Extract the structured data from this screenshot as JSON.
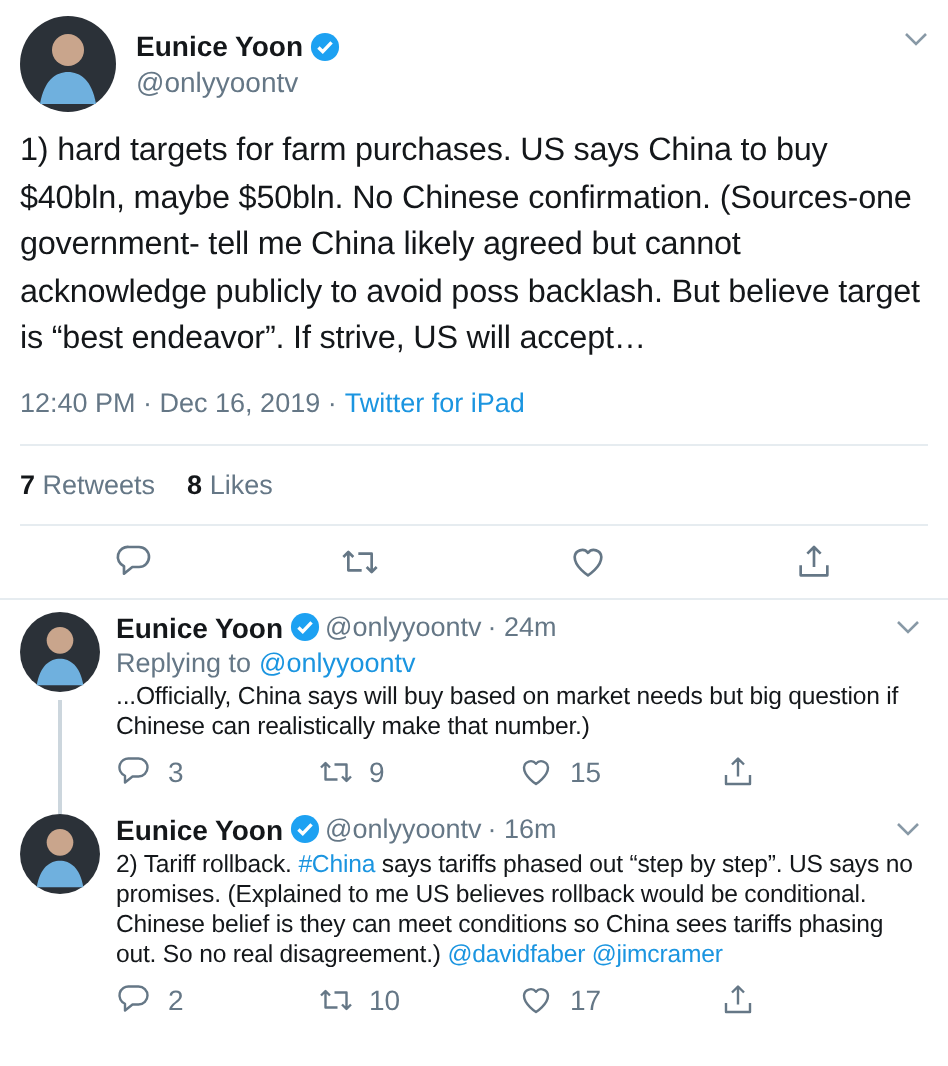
{
  "main_tweet": {
    "name": "Eunice Yoon",
    "verified": true,
    "handle": "@onlyyoontv",
    "text": "1) hard targets for farm purchases. US says China to buy $40bln, maybe $50bln. No Chinese confirmation. (Sources-one government- tell me China likely agreed but cannot acknowledge publicly to avoid poss backlash. But believe target is “best endeavor”. If strive, US will accept…",
    "timestamp": "12:40 PM · Dec 16, 2019 ·",
    "source": "Twitter for iPad",
    "stats": [
      {
        "count": "7",
        "label": "Retweets"
      },
      {
        "count": "8",
        "label": "Likes"
      }
    ],
    "actions": [
      {
        "kind": "reply"
      },
      {
        "kind": "retweet"
      },
      {
        "kind": "like"
      },
      {
        "kind": "share"
      }
    ]
  },
  "replies": [
    {
      "name": "Eunice Yoon",
      "verified": true,
      "handle": "@onlyyoontv",
      "time": "· 24m",
      "replying_label": "Replying to",
      "replying_handle": "@onlyyoontv",
      "thread_line": true,
      "segments": [
        {
          "kind": "text",
          "text": "...Officially, China says will buy based on market needs but big question if Chinese can realistically make that number.)"
        }
      ],
      "actions": [
        {
          "kind": "reply",
          "count": "3"
        },
        {
          "kind": "retweet",
          "count": "9"
        },
        {
          "kind": "like",
          "count": "15"
        },
        {
          "kind": "share"
        }
      ]
    },
    {
      "name": "Eunice Yoon",
      "verified": true,
      "handle": "@onlyyoontv",
      "time": "· 16m",
      "thread_line": false,
      "segments": [
        {
          "kind": "text",
          "text": "2) Tariff rollback."
        },
        {
          "kind": "link",
          "text": "#China"
        },
        {
          "kind": "text",
          "text": "says tariffs phased out “step by step”. US says no promises. (Explained to me US believes rollback would be conditional. Chinese belief is they can meet conditions so China sees tariffs phasing out. So no real disagreement.)"
        },
        {
          "kind": "link",
          "text": "@davidfaber"
        },
        {
          "kind": "link",
          "text": "@jimcramer"
        }
      ],
      "actions": [
        {
          "kind": "reply",
          "count": "2"
        },
        {
          "kind": "retweet",
          "count": "10"
        },
        {
          "kind": "like",
          "count": "17"
        },
        {
          "kind": "share"
        }
      ]
    }
  ]
}
